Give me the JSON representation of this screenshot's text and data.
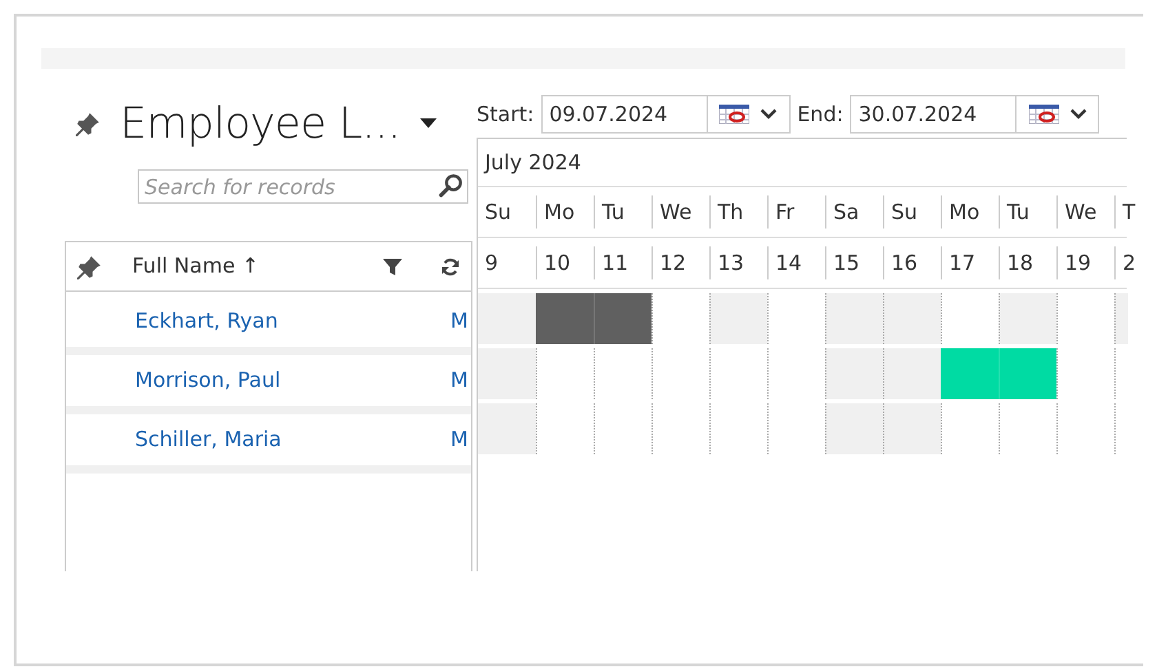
{
  "header": {
    "title": "Employee L...",
    "search": {
      "placeholder": "Search for records"
    }
  },
  "list": {
    "column": {
      "label": "Full Name",
      "sort_arrow": "↑"
    },
    "rows": [
      {
        "name": "Eckhart, Ryan",
        "column_2": "M"
      },
      {
        "name": "Morrison, Paul",
        "column_2": "M"
      },
      {
        "name": "Schiller, Maria",
        "column_2": "M"
      }
    ]
  },
  "gantt": {
    "start": {
      "label": "Start:",
      "value": "09.07.2024"
    },
    "end": {
      "label": "End:",
      "value": "30.07.2024"
    },
    "month": "July 2024",
    "weekdays": [
      "Su",
      "Mo",
      "Tu",
      "We",
      "Th",
      "Fr",
      "Sa",
      "Su",
      "Mo",
      "Tu",
      "We",
      "T"
    ],
    "days": [
      "9",
      "10",
      "11",
      "12",
      "13",
      "14",
      "15",
      "16",
      "17",
      "18",
      "19",
      "2"
    ],
    "rows": [
      {
        "cells": [
          {
            "kind": "shaded"
          },
          {
            "kind": "bar",
            "color": "#606060"
          },
          {
            "kind": "bar",
            "color": "#606060"
          },
          {
            "kind": "blank"
          },
          {
            "kind": "shaded"
          },
          {
            "kind": "blank"
          },
          {
            "kind": "shaded"
          },
          {
            "kind": "shaded"
          },
          {
            "kind": "blank"
          },
          {
            "kind": "shaded"
          },
          {
            "kind": "blank"
          },
          {
            "kind": "shaded"
          }
        ]
      },
      {
        "cells": [
          {
            "kind": "shaded"
          },
          {
            "kind": "blank"
          },
          {
            "kind": "blank"
          },
          {
            "kind": "blank"
          },
          {
            "kind": "blank"
          },
          {
            "kind": "blank"
          },
          {
            "kind": "shaded"
          },
          {
            "kind": "shaded"
          },
          {
            "kind": "bar",
            "color": "#00dba3"
          },
          {
            "kind": "bar",
            "color": "#00dba3"
          },
          {
            "kind": "blank"
          },
          {
            "kind": "blank"
          }
        ]
      },
      {
        "cells": [
          {
            "kind": "shaded"
          },
          {
            "kind": "blank"
          },
          {
            "kind": "blank"
          },
          {
            "kind": "blank"
          },
          {
            "kind": "blank"
          },
          {
            "kind": "blank"
          },
          {
            "kind": "shaded"
          },
          {
            "kind": "shaded"
          },
          {
            "kind": "blank"
          },
          {
            "kind": "blank"
          },
          {
            "kind": "blank"
          },
          {
            "kind": "blank"
          }
        ]
      }
    ]
  }
}
